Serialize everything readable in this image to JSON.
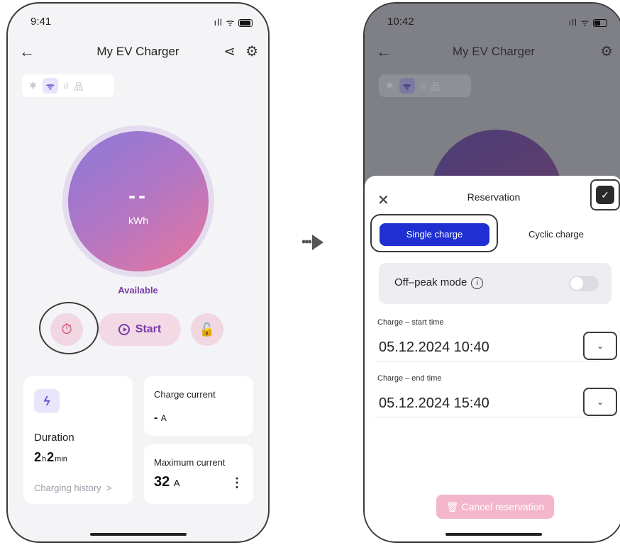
{
  "phone1": {
    "status_time": "9:41",
    "status_icons": "ıll ᯤ",
    "back_icon": "←",
    "title": "My EV Charger",
    "share_icon": "⋖",
    "gear_icon": "⚙",
    "connectivity": {
      "bluetooth": "✱",
      "wifi": "ᯤ",
      "cellular": "ıl",
      "ethernet": "品"
    },
    "energy_value": "--",
    "energy_unit": "kWh",
    "status": "Available",
    "timer_icon": "⏱",
    "start_label": "Start",
    "lock_icon": "🔓",
    "duration": {
      "bolt_icon": "ϟ",
      "label": "Duration",
      "hours": "2",
      "hours_unit": "h",
      "minutes": "2",
      "minutes_unit": "min",
      "history_label": "Charging history",
      "history_chevron": ">"
    },
    "charge_current": {
      "label": "Charge current",
      "value": "-",
      "unit": "A"
    },
    "max_current": {
      "label": "Maximum current",
      "value": "32",
      "unit": "A",
      "menu_icon": "⋮"
    }
  },
  "arrow_dots": "•••",
  "phone2": {
    "status_time": "10:42",
    "status_icons": "ıll ᯤ",
    "back_icon": "←",
    "title": "My EV Charger",
    "gear_icon": "⚙",
    "connectivity": {
      "bluetooth": "✱",
      "wifi": "ᯤ",
      "cellular": "ıl",
      "ethernet": "品"
    },
    "sheet": {
      "close_icon": "✕",
      "title": "Reservation",
      "confirm_icon": "✓",
      "tab_single": "Single charge",
      "tab_cyclic": "Cyclic charge",
      "offpeak_label": "Off–peak mode",
      "info_icon": "i",
      "start_label": "Charge – start time",
      "start_value": "05.12.2024 10:40",
      "end_label": "Charge – end time",
      "end_value": "05.12.2024 15:40",
      "chevron_icon": "⌄",
      "cancel_label": "Cancel reservation",
      "trash_icon": "🗑"
    }
  }
}
